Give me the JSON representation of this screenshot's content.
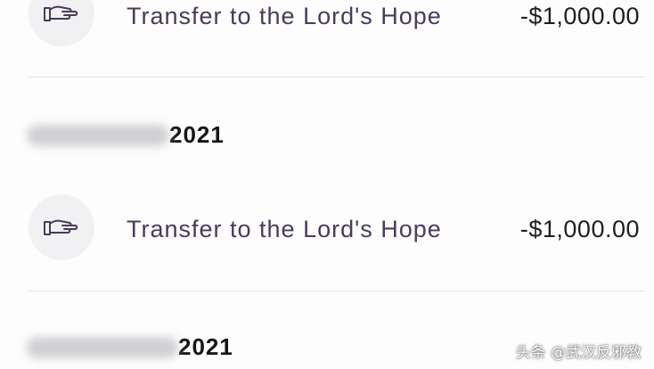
{
  "transactions": [
    {
      "icon": "hand-icon",
      "label": "Transfer to the Lord's Hope",
      "amount": "-$1,000.00"
    },
    {
      "icon": "hand-icon",
      "label": "Transfer to the Lord's Hope",
      "amount": "-$1,000.00"
    }
  ],
  "date_groups": [
    {
      "date_redacted": true,
      "year": "2021"
    },
    {
      "date_redacted": true,
      "year": "2021"
    }
  ],
  "watermark": "头条 @武汉反邪教",
  "colors": {
    "background": "#fdfdfd",
    "label": "#4a3a5c",
    "amount": "#1e1e22",
    "icon_circle": "#f1f1f3",
    "divider": "#e4e4e8"
  }
}
